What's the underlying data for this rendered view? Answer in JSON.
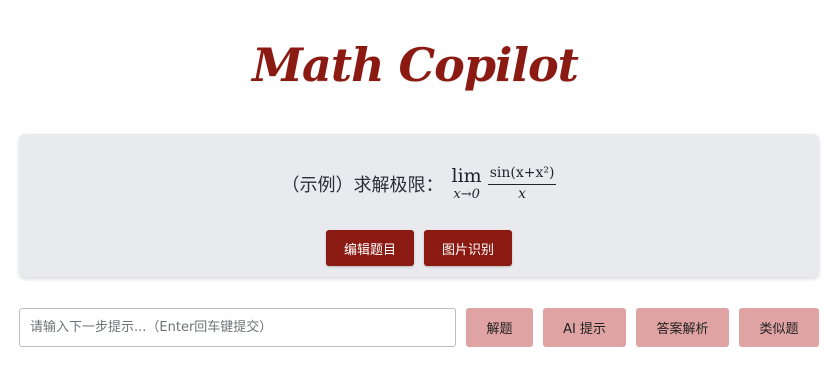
{
  "app": {
    "title": "Math Copilot"
  },
  "problem": {
    "prefix": "（示例）求解极限：",
    "lim_word": "lim",
    "lim_sub": "x→0",
    "numerator": "sin(x+x²)",
    "denominator": "x",
    "edit_button": "编辑题目",
    "image_button": "图片识别"
  },
  "input_bar": {
    "placeholder": "请输入下一步提示...（Enter回车键提交）",
    "value": "",
    "solve_button": "解题",
    "ai_hint_button": "AI 提示",
    "answer_button": "答案解析",
    "similar_button": "类似题"
  },
  "colors": {
    "brand": "#8b1a12",
    "card_bg": "#e8eaed",
    "light_button": "#e0a3a3"
  }
}
